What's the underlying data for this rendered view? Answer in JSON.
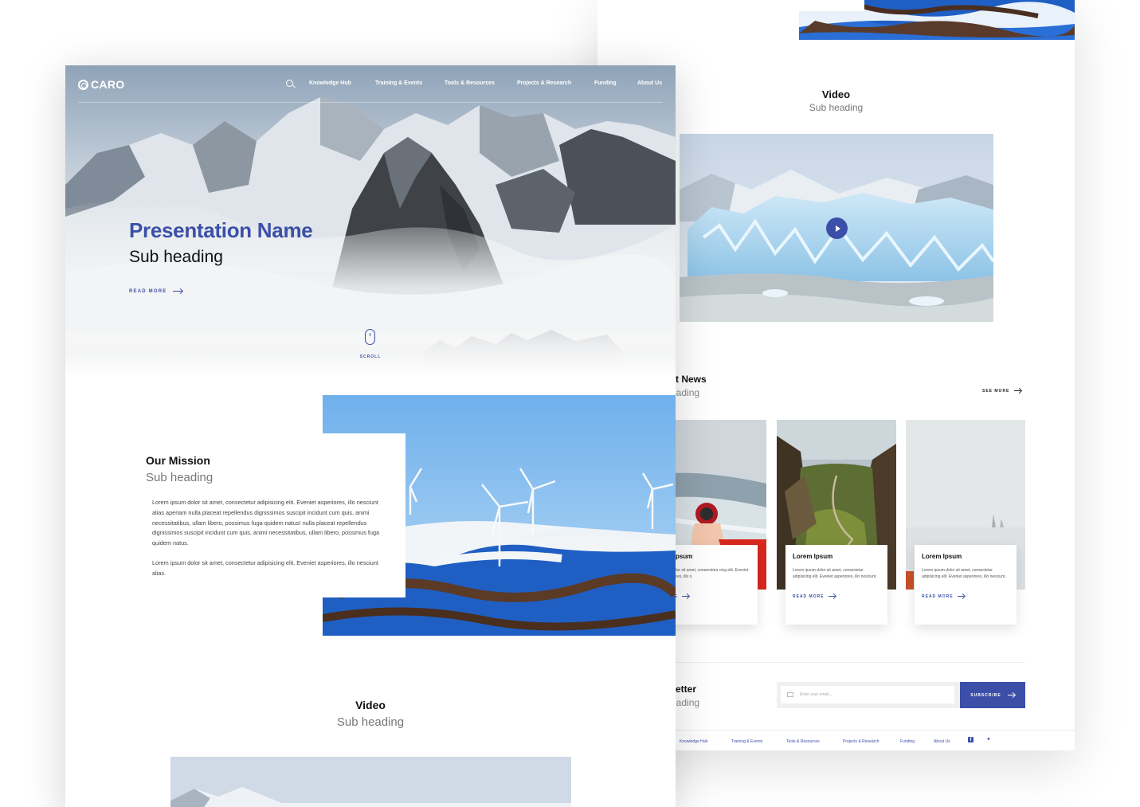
{
  "back_page": {
    "video": {
      "title": "Video",
      "sub": "Sub heading",
      "play_icon": "play-icon"
    },
    "news": {
      "title": "t News",
      "sub": "eading",
      "see_more": "SEE MORE",
      "cards": [
        {
          "title": "em Ipsum",
          "body": "sum dolor sit amet, consectetur cing elit. Eveniet asperiores, illo s.",
          "read_more": "MORE"
        },
        {
          "title": "Lorem Ipsum",
          "body": "Lorem ipsum dolor sit amet, consectetur adipisicing elit. Eveniet asperiores, illo nesciunt.",
          "read_more": "READ MORE"
        },
        {
          "title": "Lorem Ipsum",
          "body": "Lorem ipsum dolor sit amet, consectetur adipisicing elit. Eveniet asperiores, illo nesciunt.",
          "read_more": "READ MORE"
        }
      ]
    },
    "newsletter": {
      "title": "etter",
      "sub": "eading",
      "placeholder": "Enter your email...",
      "subscribe": "SUBSCRIBE"
    },
    "footer": {
      "links": [
        "Knowledge Hub",
        "Training & Events",
        "Tools & Resources",
        "Projects & Research",
        "Funding",
        "About Us"
      ],
      "social": [
        "facebook-icon",
        "twitter-icon"
      ]
    }
  },
  "front_page": {
    "logo": "CARO",
    "nav": [
      "Knowledge Hub",
      "Training & Events",
      "Tools & Resources",
      "Projects & Research",
      "Funding",
      "About Us"
    ],
    "hero": {
      "title": "Presentation Name",
      "sub": "Sub heading",
      "read_more": "READ MORE",
      "scroll": "SCROLL"
    },
    "mission": {
      "title": "Our Mission",
      "sub": "Sub heading",
      "p1": "Lorem ipsum dolor sit amet, consectetur adipisicing elit. Eveniet asperiores, illo nesciunt alias aperiam nulla placeat repellendus dignissimos suscipit incidunt cum quis, animi necessitatibus, ullam libero, possimus fuga quidem natus! nulla placeat repellendus dignissimos suscipit incidunt cum quis, animi necessitatibus, ullam libero, possimus fuga quidem natus.",
      "p2": "Lorem ipsum dolor sit amet, consectetur adipisicing elit. Eveniet asperiores, illo nesciunt alias."
    },
    "video": {
      "title": "Video",
      "sub": "Sub heading"
    }
  },
  "colors": {
    "accent": "#3c4fa8",
    "text": "#111111",
    "muted": "#777777"
  }
}
